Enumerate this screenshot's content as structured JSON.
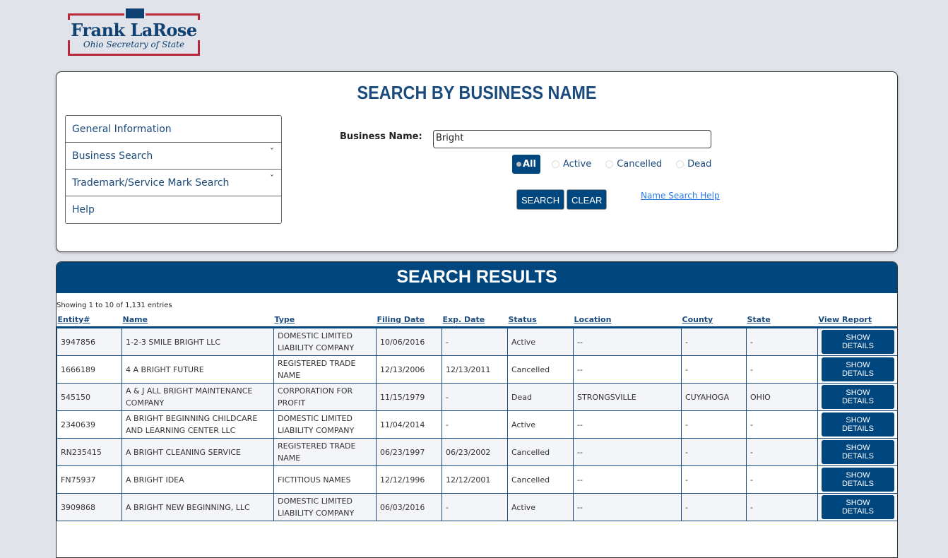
{
  "logo": {
    "name": "Frank LaRose",
    "subtitle": "Ohio Secretary of State"
  },
  "search": {
    "title": "SEARCH BY BUSINESS NAME",
    "label": "Business Name:",
    "value": "Bright",
    "filters": [
      "All",
      "Active",
      "Cancelled",
      "Dead"
    ],
    "selected_filter": "All",
    "search_label": "SEARCH",
    "clear_label": "CLEAR",
    "help_link": "Name Search Help"
  },
  "menu": [
    {
      "label": "General Information",
      "expandable": false
    },
    {
      "label": "Business Search",
      "expandable": true
    },
    {
      "label": "Trademark/Service Mark Search",
      "expandable": true
    },
    {
      "label": "Help",
      "expandable": false
    }
  ],
  "results": {
    "title": "SEARCH RESULTS",
    "info": "Showing 1 to 10 of 1,131 entries",
    "columns": [
      "Entity#",
      "Name",
      "Type",
      "Filing Date",
      "Exp. Date",
      "Status",
      "Location",
      "County",
      "State",
      "View Report"
    ],
    "button_label": "SHOW DETAILS",
    "rows": [
      [
        "3947856",
        "1-2-3 SMILE BRIGHT LLC",
        "DOMESTIC LIMITED LIABILITY COMPANY",
        "10/06/2016",
        "-",
        "Active",
        "--",
        "-",
        "-"
      ],
      [
        "1666189",
        "4 A BRIGHT FUTURE",
        "REGISTERED TRADE NAME",
        "12/13/2006",
        "12/13/2011",
        "Cancelled",
        "--",
        "-",
        "-"
      ],
      [
        "545150",
        "A & J ALL BRIGHT MAINTENANCE COMPANY",
        "CORPORATION FOR PROFIT",
        "11/15/1979",
        "-",
        "Dead",
        "STRONGSVILLE",
        "CUYAHOGA",
        "OHIO"
      ],
      [
        "2340639",
        "A BRIGHT BEGINNING CHILDCARE AND LEARNING CENTER LLC",
        "DOMESTIC LIMITED LIABILITY COMPANY",
        "11/04/2014",
        "-",
        "Active",
        "--",
        "-",
        "-"
      ],
      [
        "RN235415",
        "A BRIGHT CLEANING SERVICE",
        "REGISTERED TRADE NAME",
        "06/23/1997",
        "06/23/2002",
        "Cancelled",
        "--",
        "-",
        "-"
      ],
      [
        "FN75937",
        "A BRIGHT IDEA",
        "FICTITIOUS NAMES",
        "12/12/1996",
        "12/12/2001",
        "Cancelled",
        "--",
        "-",
        "-"
      ],
      [
        "3909868",
        "A BRIGHT NEW BEGINNING, LLC",
        "DOMESTIC LIMITED LIABILITY COMPANY",
        "06/03/2016",
        "-",
        "Active",
        "--",
        "-",
        "-"
      ]
    ]
  },
  "colors": {
    "primary": "#00467f",
    "accent": "#b8273a"
  }
}
